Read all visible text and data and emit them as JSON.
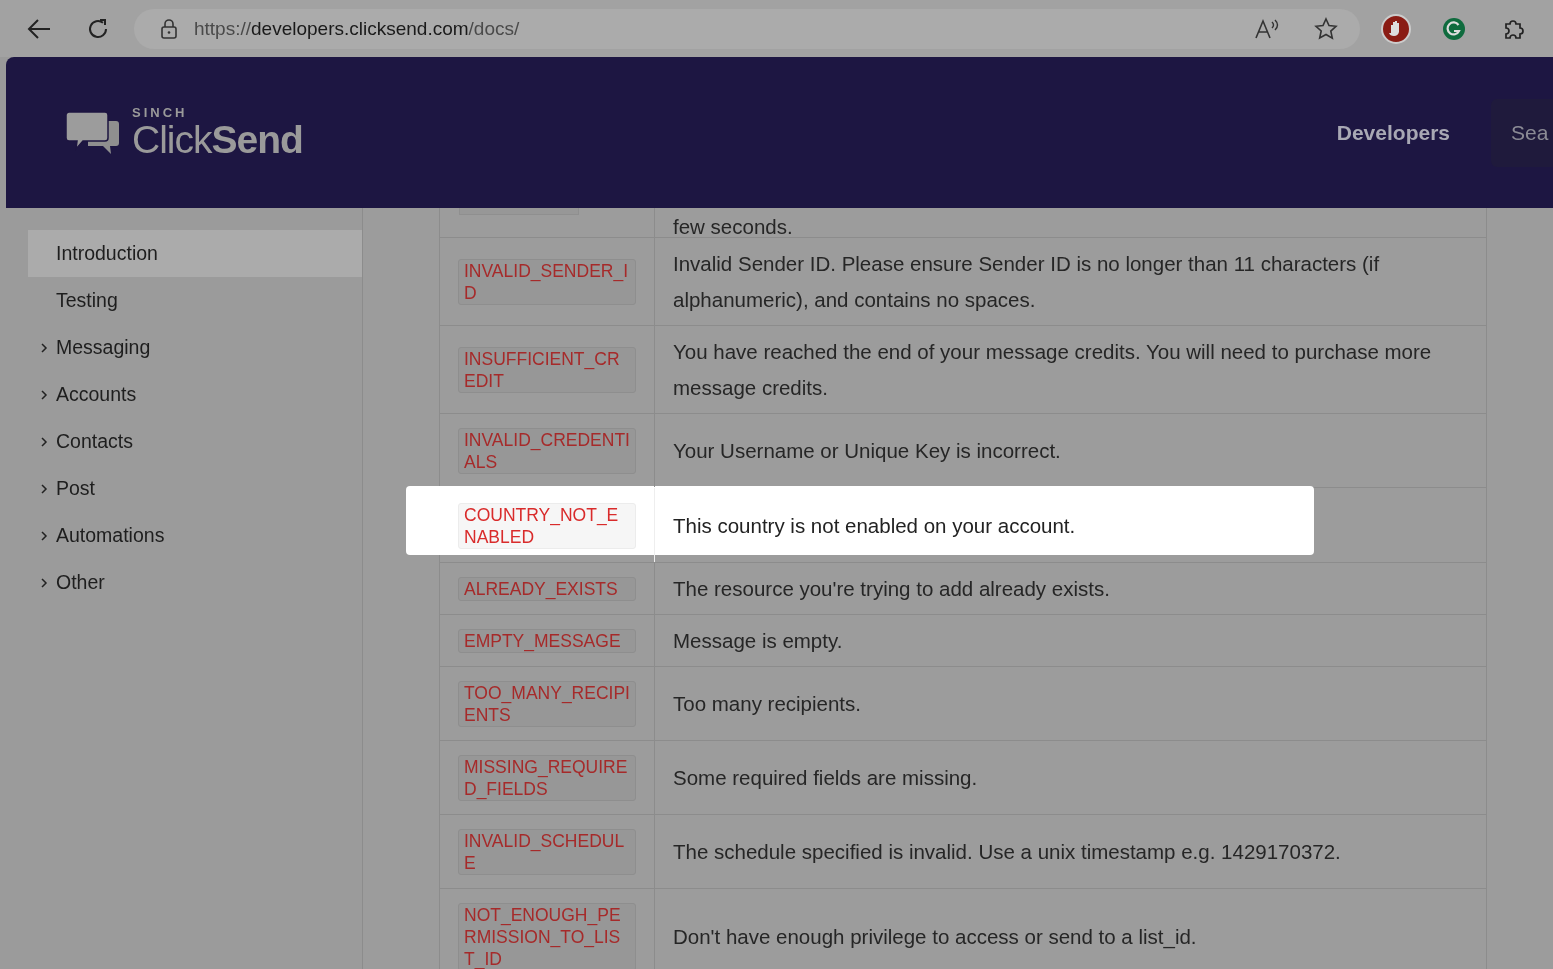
{
  "browser": {
    "url": {
      "scheme": "https://",
      "host": "developers.clicksend.com",
      "path": "/docs/"
    }
  },
  "header": {
    "logo": {
      "brand": "SINCH",
      "word_light": "Click",
      "word_bold": "Send"
    },
    "nav_link": "Developers",
    "search": {
      "placeholder": "Sea"
    }
  },
  "sidebar": {
    "items": [
      {
        "label": "Introduction",
        "selected": true,
        "expandable": false
      },
      {
        "label": "Testing",
        "selected": false,
        "expandable": false
      },
      {
        "label": "Messaging",
        "selected": false,
        "expandable": true
      },
      {
        "label": "Accounts",
        "selected": false,
        "expandable": true
      },
      {
        "label": "Contacts",
        "selected": false,
        "expandable": true
      },
      {
        "label": "Post",
        "selected": false,
        "expandable": true
      },
      {
        "label": "Automations",
        "selected": false,
        "expandable": true
      },
      {
        "label": "Other",
        "selected": false,
        "expandable": true
      }
    ]
  },
  "table": {
    "partial_row_text": "few seconds.",
    "rows": [
      {
        "code": "INVALID_SENDER_ID",
        "description": "Invalid Sender ID. Please ensure Sender ID is no longer than 11 characters (if alphanumeric), and contains no spaces.",
        "highlighted": false
      },
      {
        "code": "INSUFFICIENT_CREDIT",
        "description": "You have reached the end of your message credits. You will need to purchase more message credits.",
        "highlighted": false
      },
      {
        "code": "INVALID_CREDENTIALS",
        "description": "Your Username or Unique Key is incorrect.",
        "highlighted": false
      },
      {
        "code": "COUNTRY_NOT_ENABLED",
        "description": "This country is not enabled on your account.",
        "highlighted": true
      },
      {
        "code": "ALREADY_EXISTS",
        "description": "The resource you're trying to add already exists.",
        "highlighted": false
      },
      {
        "code": "EMPTY_MESSAGE",
        "description": "Message is empty.",
        "highlighted": false
      },
      {
        "code": "TOO_MANY_RECIPIENTS",
        "description": "Too many recipients.",
        "highlighted": false
      },
      {
        "code": "MISSING_REQUIRED_FIELDS",
        "description": "Some required fields are missing.",
        "highlighted": false
      },
      {
        "code": "INVALID_SCHEDULE",
        "description": "The schedule specified is invalid. Use a unix timestamp e.g. 1429170372.",
        "highlighted": false
      },
      {
        "code": "NOT_ENOUGH_PERMISSION_TO_LIST_ID",
        "description": "Don't have enough privilege to access or send to a list_id.",
        "highlighted": false
      }
    ]
  }
}
